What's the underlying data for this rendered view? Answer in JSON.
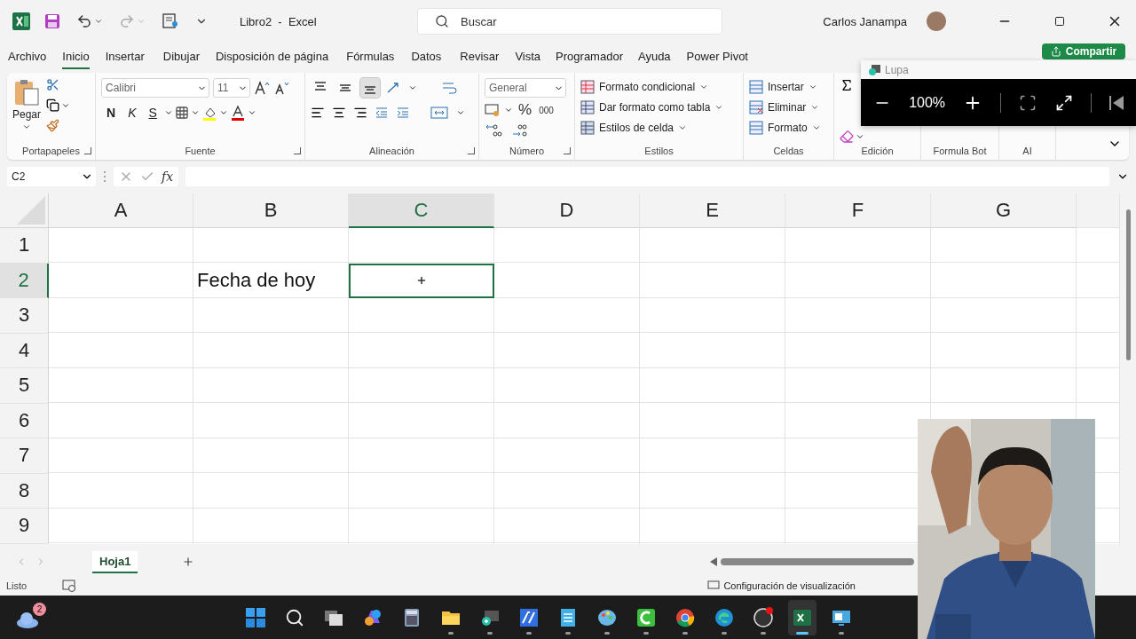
{
  "window": {
    "title": "Libro2  -  Excel",
    "search_placeholder": "Buscar",
    "user": "Carlos Janampa"
  },
  "menu_tabs": [
    {
      "label": "Archivo",
      "selected": false
    },
    {
      "label": "Inicio",
      "selected": true
    },
    {
      "label": "Insertar",
      "selected": false
    },
    {
      "label": "Dibujar",
      "selected": false
    },
    {
      "label": "Disposición de página",
      "selected": false
    },
    {
      "label": "Fórmulas",
      "selected": false
    },
    {
      "label": "Datos",
      "selected": false
    },
    {
      "label": "Revisar",
      "selected": false
    },
    {
      "label": "Vista",
      "selected": false
    },
    {
      "label": "Programador",
      "selected": false
    },
    {
      "label": "Ayuda",
      "selected": false
    },
    {
      "label": "Power Pivot",
      "selected": false
    }
  ],
  "share_button": "Compartir",
  "ribbon": {
    "clipboard": {
      "label": "Portapapeles",
      "paste": "Pegar"
    },
    "font": {
      "label": "Fuente",
      "name": "Calibri",
      "size": "11",
      "bold": "N",
      "italic": "K",
      "underline": "S"
    },
    "alignment": {
      "label": "Alineación",
      "vertical_align": [
        {
          "selected": false
        },
        {
          "selected": false
        },
        {
          "selected": true
        }
      ]
    },
    "number": {
      "label": "Número",
      "format": "General",
      "percent": "%",
      "thousands": "000"
    },
    "styles": {
      "label": "Estilos",
      "items": [
        "Formato condicional",
        "Dar formato como tabla",
        "Estilos de celda"
      ]
    },
    "cells": {
      "label": "Celdas",
      "items": [
        "Insertar",
        "Eliminar",
        "Formato"
      ]
    },
    "editing": {
      "label": "Edición"
    },
    "addins": [
      {
        "label": "Formula Bot"
      },
      {
        "label": "AI"
      }
    ]
  },
  "magnifier": {
    "title": "Lupa",
    "zoom": "100%"
  },
  "formula_bar": {
    "name_box": "C2",
    "fx": "fx"
  },
  "sheet": {
    "columns": [
      {
        "label": "A",
        "selected": false
      },
      {
        "label": "B",
        "selected": false
      },
      {
        "label": "C",
        "selected": true
      },
      {
        "label": "D",
        "selected": false
      },
      {
        "label": "E",
        "selected": false
      },
      {
        "label": "F",
        "selected": false
      },
      {
        "label": "G",
        "selected": false
      }
    ],
    "rows": [
      {
        "label": "1",
        "selected": false,
        "cells": [
          {
            "selected": false
          },
          {
            "selected": false
          },
          {
            "selected": false
          },
          {
            "selected": false
          },
          {
            "selected": false
          },
          {
            "selected": false
          },
          {
            "selected": false
          }
        ]
      },
      {
        "label": "2",
        "selected": true,
        "cells": [
          {
            "selected": false
          },
          {
            "text": "Fecha de hoy",
            "selected": false
          },
          {
            "selected": true
          },
          {
            "selected": false
          },
          {
            "selected": false
          },
          {
            "selected": false
          },
          {
            "selected": false
          }
        ]
      },
      {
        "label": "3",
        "selected": false,
        "cells": [
          {
            "selected": false
          },
          {
            "selected": false
          },
          {
            "selected": false
          },
          {
            "selected": false
          },
          {
            "selected": false
          },
          {
            "selected": false
          },
          {
            "selected": false
          }
        ]
      },
      {
        "label": "4",
        "selected": false,
        "cells": [
          {
            "selected": false
          },
          {
            "selected": false
          },
          {
            "selected": false
          },
          {
            "selected": false
          },
          {
            "selected": false
          },
          {
            "selected": false
          },
          {
            "selected": false
          }
        ]
      },
      {
        "label": "5",
        "selected": false,
        "cells": [
          {
            "selected": false
          },
          {
            "selected": false
          },
          {
            "selected": false
          },
          {
            "selected": false
          },
          {
            "selected": false
          },
          {
            "selected": false
          },
          {
            "selected": false
          }
        ]
      },
      {
        "label": "6",
        "selected": false,
        "cells": [
          {
            "selected": false
          },
          {
            "selected": false
          },
          {
            "selected": false
          },
          {
            "selected": false
          },
          {
            "selected": false
          },
          {
            "selected": false
          },
          {
            "selected": false
          }
        ]
      },
      {
        "label": "7",
        "selected": false,
        "cells": [
          {
            "selected": false
          },
          {
            "selected": false
          },
          {
            "selected": false
          },
          {
            "selected": false
          },
          {
            "selected": false
          },
          {
            "selected": false
          }
        ]
      },
      {
        "label": "8",
        "selected": false,
        "cells": [
          {
            "selected": false
          },
          {
            "selected": false
          },
          {
            "selected": false
          },
          {
            "selected": false
          },
          {
            "selected": false
          },
          {
            "selected": false
          }
        ]
      },
      {
        "label": "9",
        "selected": false,
        "cells": [
          {
            "selected": false
          },
          {
            "selected": false
          },
          {
            "selected": false
          },
          {
            "selected": false
          },
          {
            "selected": false
          },
          {
            "selected": false
          }
        ]
      }
    ]
  },
  "sheet_tabs": [
    {
      "label": "Hoja1",
      "selected": true
    }
  ],
  "status_bar": {
    "status": "Listo",
    "display_settings": "Configuración de visualización"
  },
  "taskbar": {
    "weather_badge": "2",
    "apps": [
      {
        "kind": "start",
        "selected": false
      },
      {
        "kind": "search",
        "selected": false
      },
      {
        "kind": "taskview",
        "selected": false
      },
      {
        "kind": "copilot",
        "selected": false
      },
      {
        "kind": "calculator",
        "selected": false
      },
      {
        "kind": "folder",
        "selected": false
      },
      {
        "kind": "magnifier",
        "selected": false
      },
      {
        "kind": "editor",
        "selected": false
      },
      {
        "kind": "notepad",
        "selected": false
      },
      {
        "kind": "paint",
        "selected": false
      },
      {
        "kind": "recorder",
        "selected": false
      },
      {
        "kind": "chrome",
        "selected": false
      },
      {
        "kind": "edge",
        "selected": false
      },
      {
        "kind": "obs",
        "selected": false
      },
      {
        "kind": "excel",
        "selected": true
      },
      {
        "kind": "screen",
        "selected": false
      }
    ]
  }
}
